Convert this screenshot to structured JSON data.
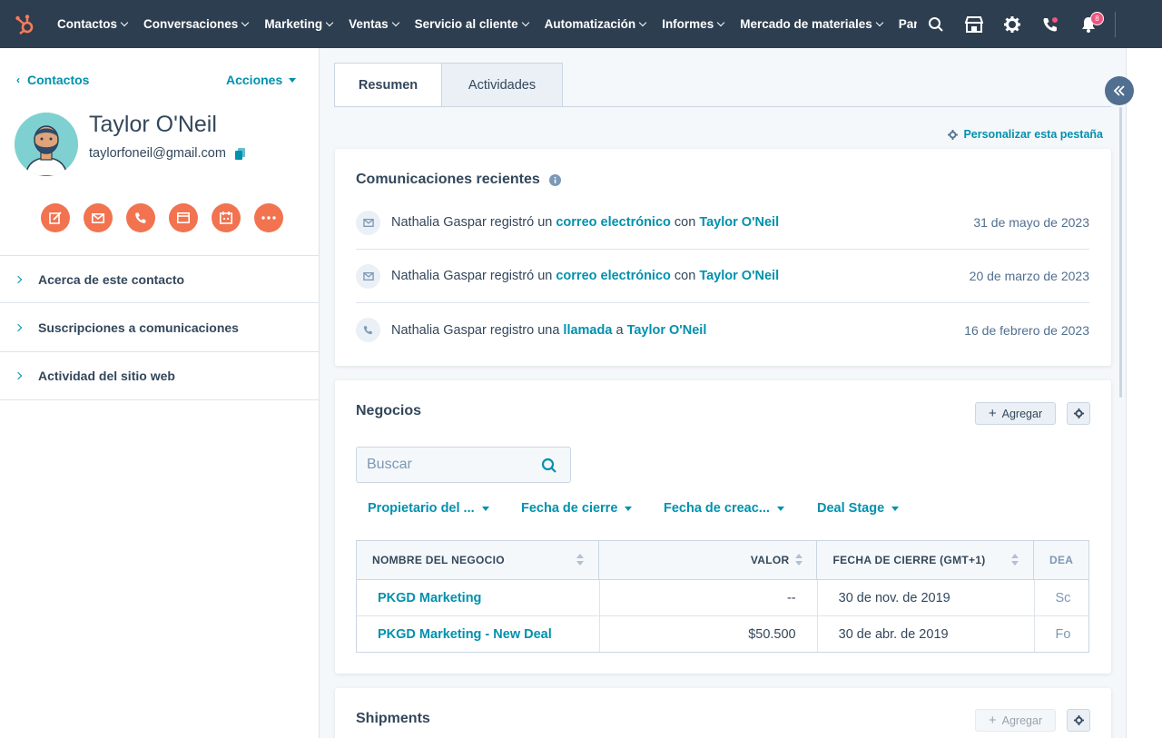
{
  "nav": {
    "items": [
      "Contactos",
      "Conversaciones",
      "Marketing",
      "Ventas",
      "Servicio al cliente",
      "Automatización",
      "Informes",
      "Mercado de materiales",
      "Part"
    ],
    "notification_count": "8"
  },
  "contact": {
    "back_label": "Contactos",
    "actions_label": "Acciones",
    "name": "Taylor O'Neil",
    "email": "taylorfoneil@gmail.com"
  },
  "sections": [
    "Acerca de este contacto",
    "Suscripciones a comunicaciones",
    "Actividad del sitio web"
  ],
  "tabs": [
    "Resumen",
    "Actividades"
  ],
  "customize_label": "Personalizar esta pestaña",
  "communications": {
    "title": "Comunicaciones recientes",
    "items": [
      {
        "who": "Nathalia Gaspar",
        "verb": "registró un",
        "object": "correo electrónico",
        "prep": "con",
        "target": "Taylor O'Neil",
        "date": "31 de mayo de 2023",
        "icon": "email-icon"
      },
      {
        "who": "Nathalia Gaspar",
        "verb": "registró un",
        "object": "correo electrónico",
        "prep": "con",
        "target": "Taylor O'Neil",
        "date": "20 de marzo de 2023",
        "icon": "email-icon"
      },
      {
        "who": "Nathalia Gaspar",
        "verb": "registro una",
        "object": "llamada",
        "prep": "a",
        "target": "Taylor O'Neil",
        "date": "16 de febrero de 2023",
        "icon": "phone-icon"
      }
    ]
  },
  "deals": {
    "title": "Negocios",
    "add_label": "Agregar",
    "search_placeholder": "Buscar",
    "filters": [
      "Propietario del ...",
      "Fecha de cierre",
      "Fecha de creac...",
      "Deal Stage"
    ],
    "columns": [
      "NOMBRE DEL NEGOCIO",
      "VALOR",
      "FECHA DE CIERRE (GMT+1)",
      "DEA"
    ],
    "rows": [
      {
        "name": "PKGD Marketing",
        "value": "--",
        "close": "30 de nov. de 2019",
        "stage": "Sc"
      },
      {
        "name": "PKGD Marketing - New Deal",
        "value": "$50.500",
        "close": "30 de abr. de 2019",
        "stage": "Fo"
      }
    ]
  },
  "shipments": {
    "title": "Shipments",
    "add_label": "Agregar"
  },
  "colors": {
    "nav_bg": "#2d3e50",
    "accent": "#0091ae",
    "action_orange": "#f2734f",
    "badge_pink": "#f2547d",
    "logo_orange": "#ff7a59"
  }
}
